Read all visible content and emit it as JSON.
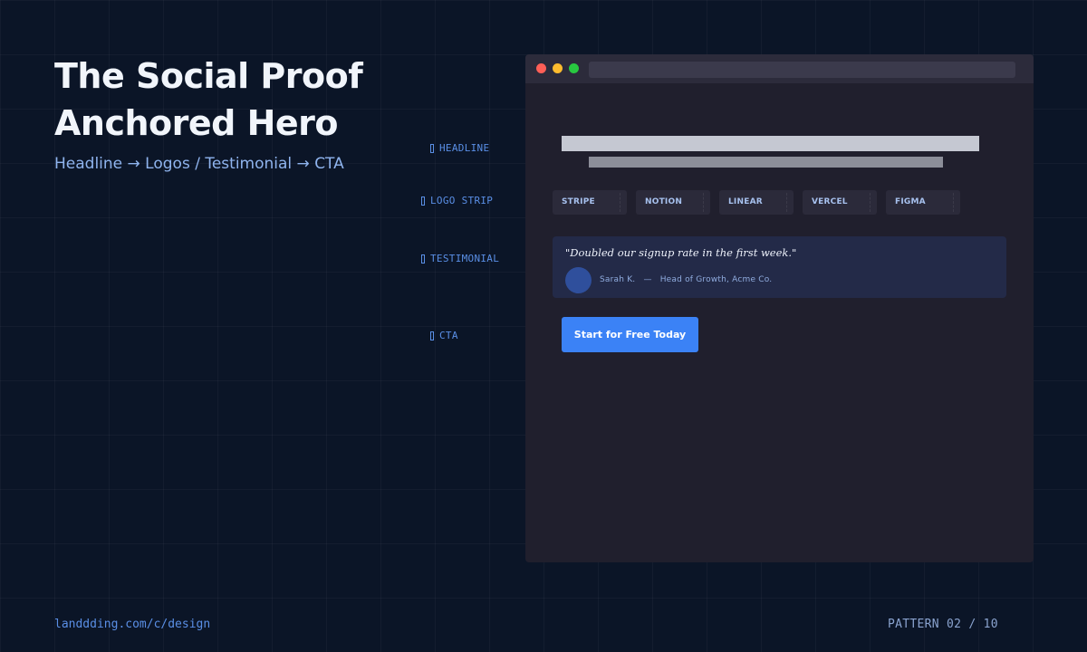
{
  "title": "The Social Proof Anchored Hero",
  "subtitle": "Headline → Logos / Testimonial → CTA",
  "annotations": {
    "headline": "HEADLINE",
    "logo_strip": "LOGO STRIP",
    "testimonial": "TESTIMONIAL",
    "cta": "CTA"
  },
  "mockup": {
    "logos": [
      "STRIPE",
      "NOTION",
      "LINEAR",
      "VERCEL",
      "FIGMA"
    ],
    "testimonial": {
      "quote": "\"Doubled our signup rate in the first week.\"",
      "author": "Sarah K.",
      "separator": "—",
      "role": "Head of Growth, Acme Co."
    },
    "cta_label": "Start for Free Today"
  },
  "footer": {
    "url": "landdding.com/c/design",
    "pattern": "PATTERN 02 / 10"
  },
  "colors": {
    "background": "#0b1527",
    "accent": "#3b82f6",
    "annotation": "#5a8fe6",
    "browser": "#201f2d"
  }
}
